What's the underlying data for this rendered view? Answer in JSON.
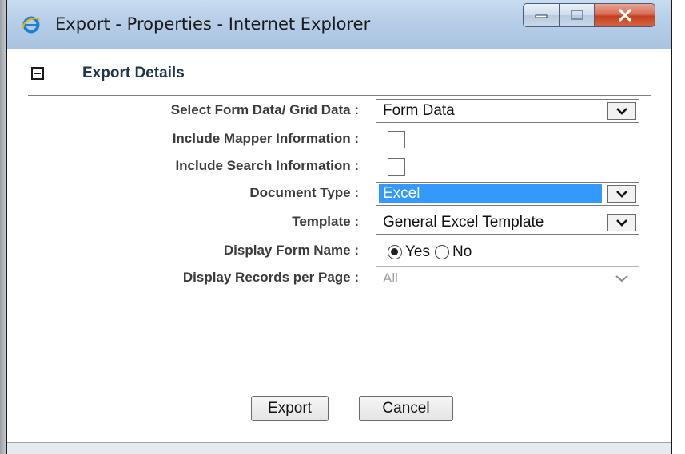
{
  "window": {
    "title": "Export - Properties - Internet Explorer"
  },
  "section": {
    "title": "Export Details"
  },
  "form": {
    "form_grid_label": "Select Form Data/ Grid Data :",
    "form_grid_value": "Form Data",
    "mapper_label": "Include Mapper Information :",
    "mapper_checked": false,
    "search_label": "Include Search Information :",
    "search_checked": false,
    "doc_type_label": "Document Type :",
    "doc_type_value": "Excel",
    "template_label": "Template :",
    "template_value": "General Excel Template",
    "display_form_name_label": "Display Form Name :",
    "display_form_name_yes": "Yes",
    "display_form_name_no": "No",
    "display_form_name_selected": "Yes",
    "records_per_page_label": "Display Records per Page :",
    "records_per_page_value": "All"
  },
  "buttons": {
    "export": "Export",
    "cancel": "Cancel"
  },
  "colors": {
    "selection": "#3399ff",
    "section_title": "#1f3550",
    "close_button": "#c2401f"
  }
}
